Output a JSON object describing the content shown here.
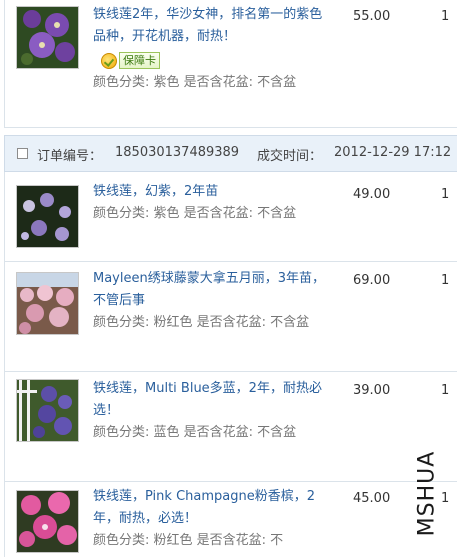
{
  "order_header": {
    "order_no_label": "订单编号：",
    "order_no": "185030137489389",
    "time_label": "成交时间：",
    "time_value": "2012-12-29 17:12"
  },
  "items": [
    {
      "title": "铁线莲2年，华沙女神，排名第一的紫色品种，开花机器，耐热！",
      "badge": "保障卡",
      "sku": "颜色分类: 紫色 是否含花盆: 不含盆",
      "price": "55.00",
      "qty": "1"
    },
    {
      "title": "铁线莲，幻紫，2年苗",
      "sku": "颜色分类: 紫色 是否含花盆: 不含盆",
      "price": "49.00",
      "qty": "1"
    },
    {
      "title": "Mayleen绣球藤蒙大拿五月丽，3年苗，不管后事",
      "sku": "颜色分类: 粉红色 是否含花盆: 不含盆",
      "price": "69.00",
      "qty": "1"
    },
    {
      "title": "铁线莲，Multi Blue多蓝，2年，耐热必选！",
      "sku": "颜色分类: 蓝色 是否含花盆: 不含盆",
      "price": "39.00",
      "qty": "1"
    },
    {
      "title": "铁线莲，Pink Champagne粉香槟，2年，耐热，必选！",
      "sku": "颜色分类: 粉红色 是否含花盆: 不",
      "price": "45.00",
      "qty": "1"
    }
  ],
  "watermark": "MSHUA",
  "colors": {
    "link": "#2a5f9c",
    "header_bg": "#e9f1f9",
    "border": "#dbe3ea"
  }
}
